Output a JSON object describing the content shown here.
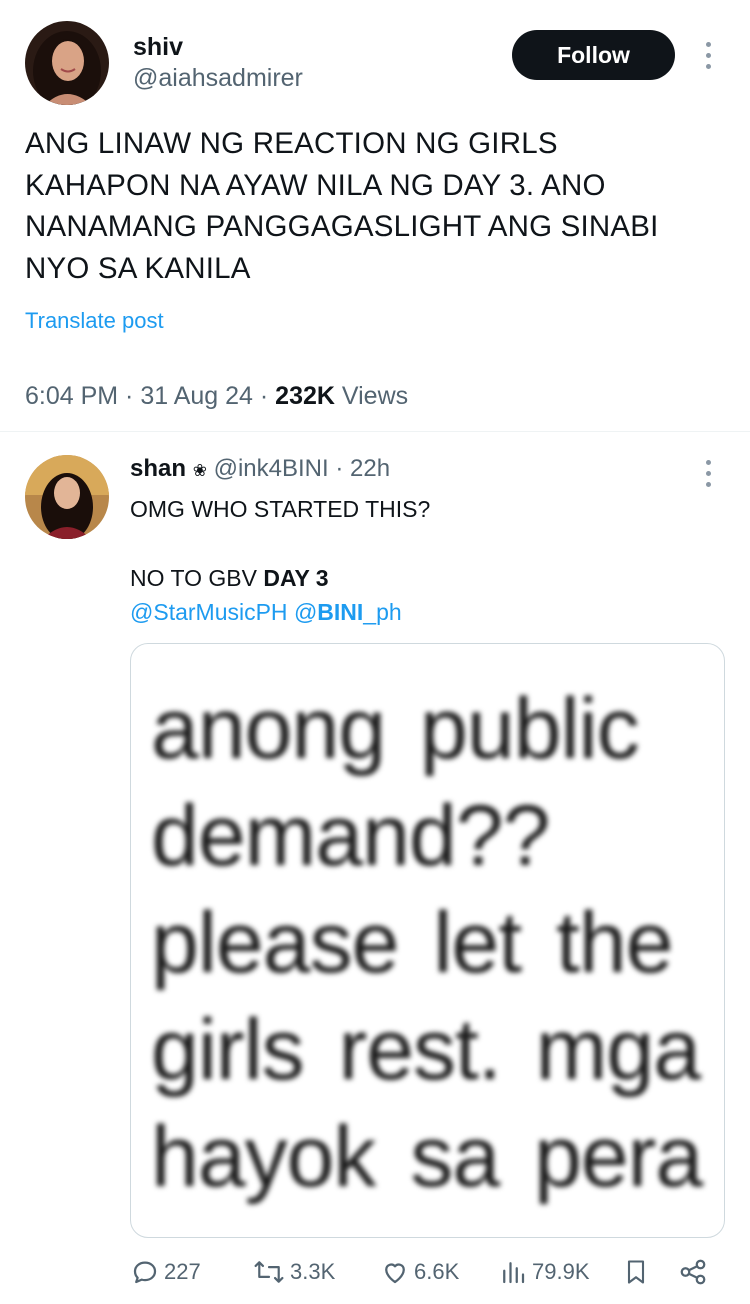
{
  "tweet": {
    "author_name": "shiv",
    "author_handle": "@aiahsadmirer",
    "follow_label": "Follow",
    "text": "ANG LINAW NG REACTION NG GIRLS\nKAHAPON NA AYAW NILA NG DAY 3. ANO\nNANAMANG PANGGAGASLIGHT ANG SINABI\nNYO SA KANILA",
    "translate_label": "Translate post",
    "time": "6:04 PM",
    "date": "31 Aug 24",
    "views_count": "232K",
    "views_label": "Views"
  },
  "reply": {
    "author_name": "shan",
    "author_handle": "@ink4BINI",
    "age": "22h",
    "line1": "OMG WHO STARTED THIS?",
    "line2_prefix": "NO TO GBV ",
    "line2_bold": "DAY 3",
    "mention1": "@StarMusicPH",
    "mention2_prefix": "@",
    "mention2_bold": "BINI",
    "mention2_suffix": "_ph",
    "image_text": "anong  public\ndemand??\nplease  let  the\ngirls rest. mga\nhayok sa pera",
    "replies": "227",
    "reposts": "3.3K",
    "likes": "6.6K",
    "views": "79.9K"
  },
  "colors": {
    "accent": "#1d9bf0",
    "text": "#0f1419",
    "muted": "#536471",
    "follow_bg": "#0f1419"
  },
  "icons": [
    "more-vertical-icon",
    "reply-icon",
    "repost-icon",
    "like-icon",
    "views-icon",
    "bookmark-icon",
    "share-icon",
    "verified-flower-icon"
  ]
}
